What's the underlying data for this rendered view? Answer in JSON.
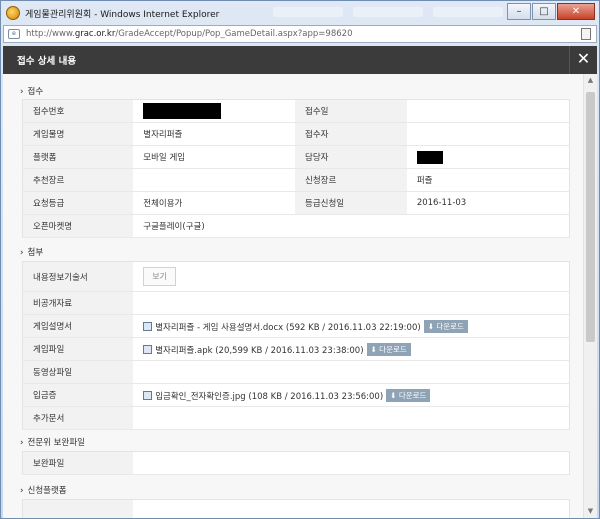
{
  "window": {
    "title": "게임물관리위원회 - Windows Internet Explorer",
    "minimize": "–",
    "maximize": "□",
    "close": "✕"
  },
  "address": {
    "prefix": "http://www.",
    "host": "grac.or.kr",
    "path": "/GradeAccept/Popup/Pop_GameDetail.aspx?app=98620"
  },
  "popup": {
    "title": "접수 상세 내용",
    "close": "✕"
  },
  "sections": {
    "reception": "접수",
    "attachments": "첨부",
    "expert": "전문위 보완파일",
    "platform": "신청플랫폼"
  },
  "reception": {
    "rows": [
      {
        "label1": "접수번호",
        "value1": "",
        "label2": "접수일",
        "value2": ""
      },
      {
        "label1": "게임물명",
        "value1": "별자리퍼즐",
        "label2": "접수자",
        "value2": ""
      },
      {
        "label1": "플랫폼",
        "value1": "모바일 게임",
        "label2": "담당자",
        "value2": ""
      },
      {
        "label1": "추천장르",
        "value1": "",
        "label2": "신청장르",
        "value2": "퍼즐"
      },
      {
        "label1": "요청등급",
        "value1": "전체이용가",
        "label2": "등급신청일",
        "value2": "2016-11-03"
      },
      {
        "label1": "오픈마켓명",
        "value1": "구글플레이(구글)",
        "label2": "",
        "value2": ""
      }
    ]
  },
  "attachments": {
    "view_button": "보기",
    "download_label": "⬇ 다운로드",
    "rows": [
      {
        "label": "내용정보기술서",
        "file": ""
      },
      {
        "label": "비공개자료",
        "file": ""
      },
      {
        "label": "게임설명서",
        "file": "별자리퍼즐 - 게임 사용설명서.docx (592 KB / 2016.11.03 22:19:00)"
      },
      {
        "label": "게임파일",
        "file": "별자리퍼즐.apk (20,599 KB / 2016.11.03 23:38:00)"
      },
      {
        "label": "동영상파일",
        "file": ""
      },
      {
        "label": "입금증",
        "file": "입금확인_전자확인증.jpg (108 KB / 2016.11.03 23:56:00)"
      },
      {
        "label": "추가문서",
        "file": ""
      }
    ]
  },
  "expert": {
    "rows": [
      {
        "label": "보완파일",
        "value": ""
      }
    ]
  }
}
